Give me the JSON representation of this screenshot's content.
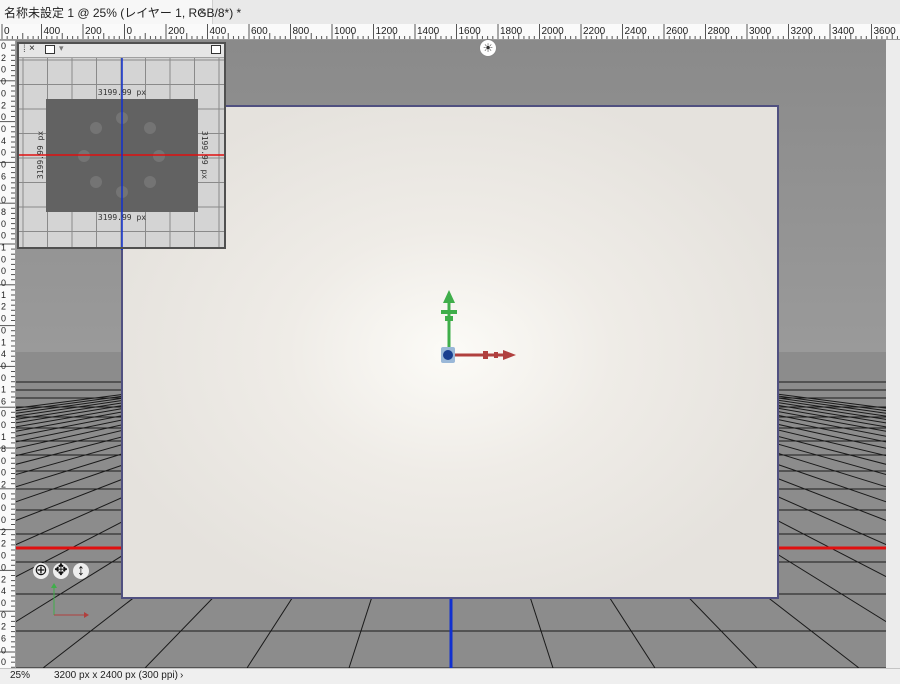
{
  "tab": {
    "title": "名称未設定 1 @ 25% (レイヤー 1, RGB/8*) *",
    "close_glyph": "×"
  },
  "ruler_top": {
    "labels": [
      "0",
      "400",
      "200",
      "0",
      "200",
      "400",
      "600",
      "800",
      "1000",
      "1200",
      "1400",
      "1600",
      "1800",
      "2000",
      "2200",
      "2400",
      "2600",
      "2800",
      "3000",
      "3200",
      "3400",
      "3600"
    ]
  },
  "ruler_left": {
    "labels": [
      "0",
      "2",
      "0",
      "0",
      "0",
      "2",
      "0",
      "0",
      "4",
      "0",
      "0",
      "6",
      "0",
      "0",
      "8",
      "0",
      "0",
      "1",
      "0",
      "0",
      "0",
      "1",
      "2",
      "0",
      "0",
      "1",
      "4",
      "0",
      "0",
      "1",
      "6",
      "0",
      "0",
      "1",
      "8",
      "0",
      "0",
      "2",
      "0",
      "0",
      "0",
      "2",
      "2",
      "0",
      "0",
      "2",
      "4",
      "0",
      "0",
      "2",
      "6",
      "0",
      "0"
    ]
  },
  "navigator": {
    "dim_top": "3199.99 px",
    "dim_bottom": "3199.99 px",
    "dim_left": "3199.99 px",
    "dim_right": "3199.99 px",
    "close_glyph": "×"
  },
  "toolbar_widgets": {
    "orbit_glyph": "⊕",
    "pan_glyph": "✥",
    "dolly_glyph": "↕"
  },
  "light_glyph": "☀",
  "status": {
    "zoom": "25%",
    "doc_info": "3200 px x 2400 px (300 ppi)",
    "arrow": "›"
  },
  "colors": {
    "axis_x": "#b0403e",
    "axis_y": "#3fae4a",
    "ground_line_red": "#e01010",
    "ground_line_blue": "#1030d0",
    "canvas_border": "#505080"
  }
}
